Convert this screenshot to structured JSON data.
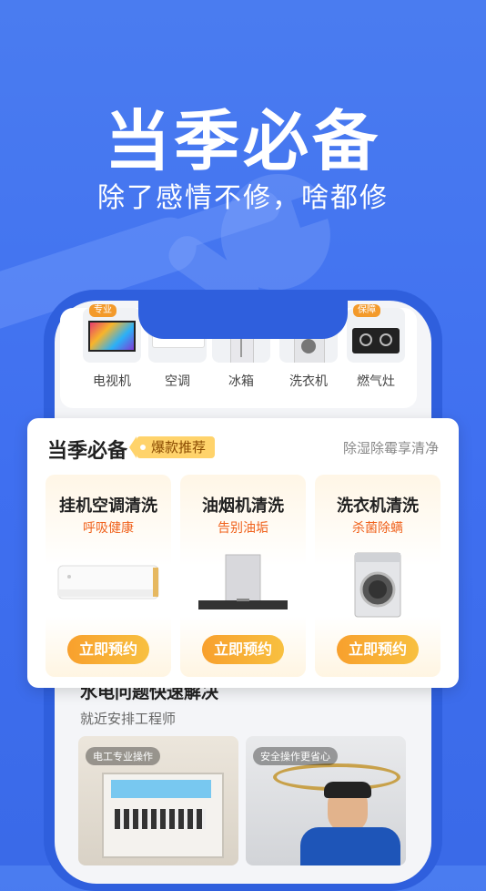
{
  "hero": {
    "title": "当季必备",
    "subtitle": "除了感情不修，啥都修"
  },
  "categories": [
    {
      "label": "电视机",
      "tag": "专业",
      "icon": "tv-icon"
    },
    {
      "label": "空调",
      "tag": "",
      "icon": "air-conditioner-icon"
    },
    {
      "label": "冰箱",
      "tag": "",
      "icon": "fridge-icon"
    },
    {
      "label": "洗衣机",
      "tag": "",
      "icon": "washer-icon"
    },
    {
      "label": "燃气灶",
      "tag": "保障",
      "icon": "gas-stove-icon"
    }
  ],
  "season": {
    "title": "当季必备",
    "badge": "爆款推荐",
    "promo": "除湿除霉享清净",
    "services": [
      {
        "name": "挂机空调清洗",
        "desc": "呼吸健康",
        "button": "立即预约",
        "icon": "air-conditioner-icon"
      },
      {
        "name": "油烟机清洗",
        "desc": "告别油垢",
        "button": "立即预约",
        "icon": "range-hood-icon"
      },
      {
        "name": "洗衣机清洗",
        "desc": "杀菌除螨",
        "button": "立即预约",
        "icon": "washer-icon"
      }
    ]
  },
  "repair": {
    "title": "水电问题快速解决",
    "subtitle": "就近安排工程师",
    "photos": [
      {
        "caption": "电工专业操作"
      },
      {
        "caption": "安全操作更省心"
      }
    ]
  },
  "colors": {
    "brand_blue": "#4a7cf0",
    "accent_orange": "#f8a02d",
    "desc_red": "#f0621d"
  }
}
